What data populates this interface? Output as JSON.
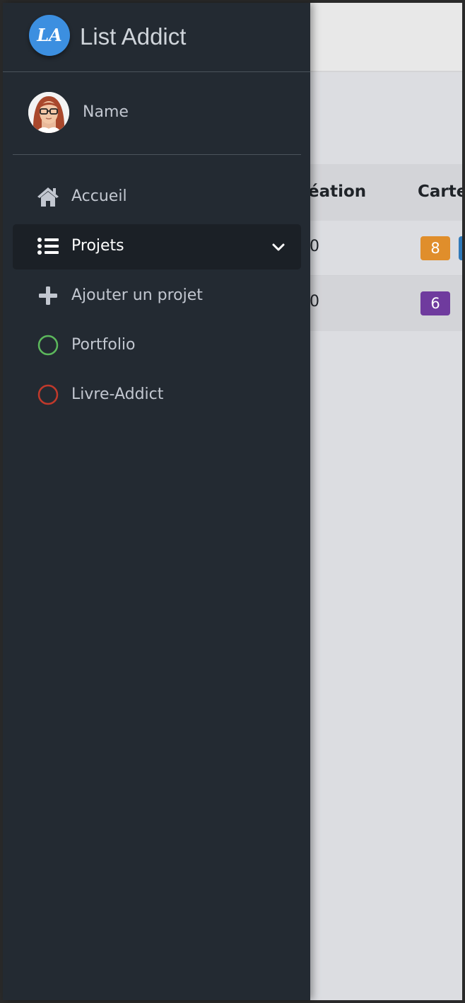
{
  "app": {
    "title": "List Addict",
    "logo_text": "LA"
  },
  "user": {
    "name": "Name"
  },
  "nav": {
    "items": [
      {
        "label": "Accueil",
        "icon": "home-icon"
      },
      {
        "label": "Projets",
        "icon": "list-icon",
        "active": true
      },
      {
        "label": "Ajouter un projet",
        "icon": "plus-icon"
      },
      {
        "label": "Portfolio",
        "icon": "circle-outline-icon",
        "color": "#5cb85c"
      },
      {
        "label": "Livre-Addict",
        "icon": "circle-outline-icon",
        "color": "#c0392b"
      }
    ]
  },
  "table": {
    "headers": [
      "éation",
      "Carte"
    ],
    "rows": [
      {
        "date_fragment": "0",
        "badge": "8",
        "badge_color": "#e08e2b"
      },
      {
        "date_fragment": "0",
        "badge": "6",
        "badge_color": "#6f3b9e"
      }
    ]
  },
  "colors": {
    "sidebar": "#232a32",
    "accent": "#3c8fe0"
  }
}
